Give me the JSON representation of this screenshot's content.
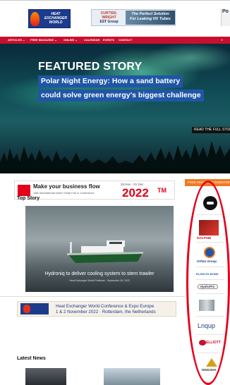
{
  "header": {
    "logo_line1": "HEAT",
    "logo_line2": "EXCHANGER",
    "logo_line3": "WORLD",
    "ad_brand_line1": "CURTISS-",
    "ad_brand_line2": "WRIGHT",
    "ad_brand_sub": "EST Group",
    "ad_tagline_line1": "The Perfect Solution",
    "ad_tagline_line2": "For Leaking HX Tubes",
    "ad2_text": "Po"
  },
  "nav": {
    "items": [
      "ARTICLES ⌄",
      "FREE MAGAZINE ⌄",
      "ONLINE ⌄",
      "CALENDAR",
      "EVENTS",
      "CONTACT"
    ],
    "search_glyph": "f"
  },
  "hero": {
    "label": "FEATURED STORY",
    "headline_line1": "Polar Night Energy: How a sand battery",
    "headline_line2": "could solve green energy's biggest challenge",
    "read_more": "READ THE FULL STORY"
  },
  "biz_ad": {
    "headline": "Make your business flow",
    "subtitle": "13th International Valve Trade Fair & Conference",
    "dates": "29 Nov - 01 Dec",
    "year": "2022",
    "mark": "TM"
  },
  "sidebar": {
    "free_magazine": "FREE MAGAZINE SUBSCRIPTION",
    "logos": [
      "DOLPHIN",
      "Orhan Group",
      "ELGIN EX BOND",
      "HydroPro",
      "Lnqup",
      "ELLIOTT",
      "DINGSHA"
    ]
  },
  "top_story": {
    "section_title": "Top Story",
    "caption": "Hydroniq to deliver cooling system to stern trawler",
    "source": "Heat Exchanger World Publisher · September 26, 2022"
  },
  "conference_ad": {
    "line1": "Heat Exchanger World Conference & Expo Europe",
    "line2": "1 & 2 November 2022 · Rotterdam, the Netherlands"
  },
  "latest_news": {
    "section_title": "Latest News"
  },
  "colors": {
    "nav_red": "#c8102e",
    "headline_blue": "#1f56a6",
    "brand_orange": "#f07a20",
    "annotation_red": "#e3001b"
  }
}
